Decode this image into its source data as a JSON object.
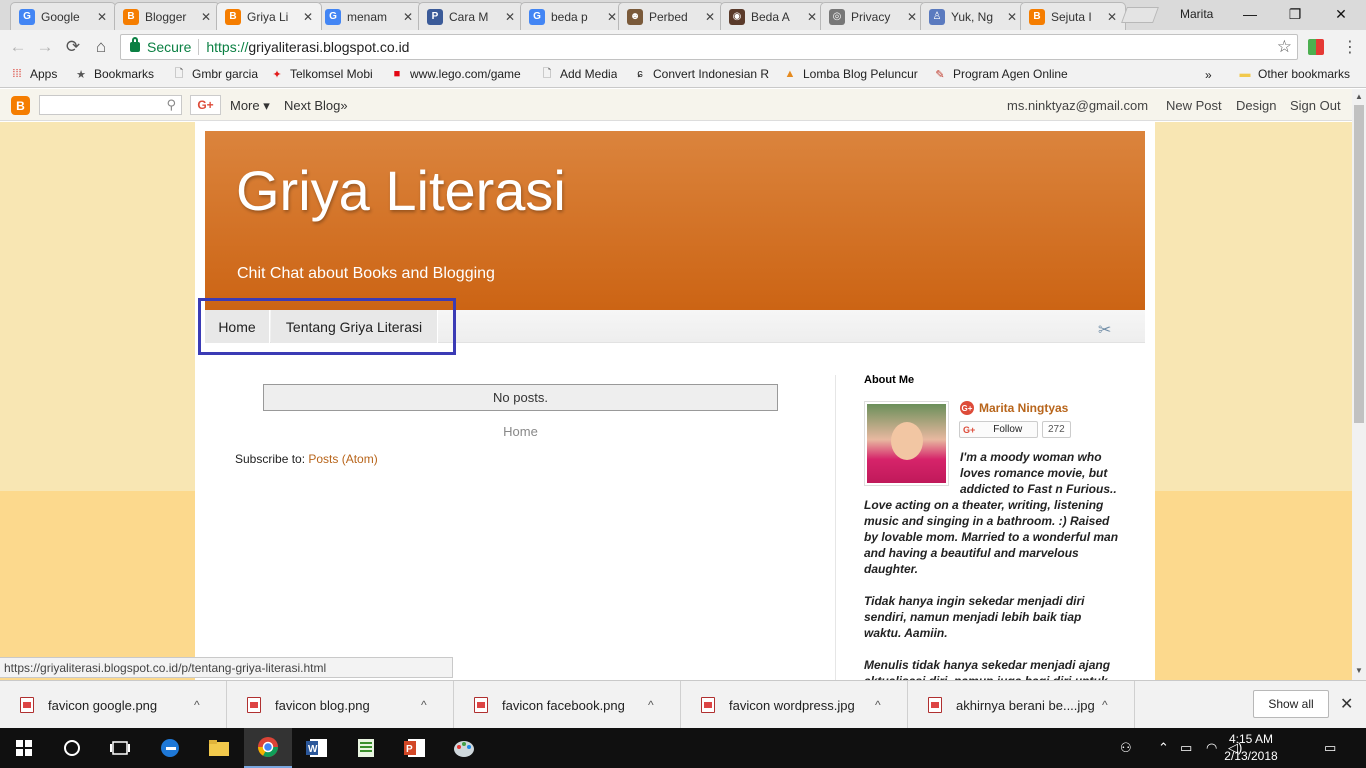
{
  "browser": {
    "tabs": [
      {
        "label": "Google",
        "icon": "google-g-icon",
        "color": "#4285f4",
        "glyph": "G",
        "active": false
      },
      {
        "label": "Blogger",
        "icon": "blogger-icon",
        "color": "#f57d00",
        "glyph": "B",
        "active": false
      },
      {
        "label": "Griya Li",
        "icon": "blogger-icon",
        "color": "#f57d00",
        "glyph": "B",
        "active": true
      },
      {
        "label": "menam",
        "icon": "google-g-icon",
        "color": "#4285f4",
        "glyph": "G",
        "active": false
      },
      {
        "label": "Cara M",
        "icon": "p-icon",
        "color": "#3b5b99",
        "glyph": "P",
        "active": false
      },
      {
        "label": "beda p",
        "icon": "google-g-icon",
        "color": "#4285f4",
        "glyph": "G",
        "active": false
      },
      {
        "label": "Perbed",
        "icon": "person-icon",
        "color": "#7a5a3a",
        "glyph": "☻",
        "active": false
      },
      {
        "label": "Beda A",
        "icon": "circle-logo-icon",
        "color": "#5a3a2a",
        "glyph": "◉",
        "active": false
      },
      {
        "label": "Privacy",
        "icon": "eye-icon",
        "color": "#777777",
        "glyph": "◎",
        "active": false
      },
      {
        "label": "Yuk, Ng",
        "icon": "figure-icon",
        "color": "#5a7abf",
        "glyph": "♙",
        "active": false
      },
      {
        "label": "Sejuta I",
        "icon": "blogger-icon",
        "color": "#f57d00",
        "glyph": "B",
        "active": false
      }
    ],
    "profile_name": "Marita",
    "window_buttons": {
      "minimize": "—",
      "restore": "❐",
      "close": "✕"
    },
    "nav": {
      "back": "←",
      "forward": "→",
      "reload": "⟳",
      "home": "⌂"
    },
    "omnibox": {
      "secure_label": "Secure",
      "url_prefix": "https://",
      "url_rest": "griyaliterasi.blogspot.co.id"
    },
    "star": "☆",
    "menu": "⋮",
    "bookmarks": [
      {
        "label": "Apps",
        "icon": "apps-grid-icon",
        "glyph": "⁞⁞⁞",
        "color": "#d93025"
      },
      {
        "label": "Bookmarks",
        "icon": "star-icon",
        "glyph": "★",
        "color": "#555555"
      },
      {
        "label": "Gmbr garcia",
        "icon": "page-icon",
        "glyph": "🗋",
        "color": "#666666"
      },
      {
        "label": "Telkomsel Mobi",
        "icon": "telkomsel-icon",
        "glyph": "✦",
        "color": "#e21a1a"
      },
      {
        "label": "www.lego.com/game",
        "icon": "lego-icon",
        "glyph": "■",
        "color": "#e30613"
      },
      {
        "label": "Add Media",
        "icon": "page-icon",
        "glyph": "🗋",
        "color": "#666666"
      },
      {
        "label": "Convert Indonesian R",
        "icon": "swirl-icon",
        "glyph": "ɕ",
        "color": "#222222"
      },
      {
        "label": "Lomba Blog Peluncur",
        "icon": "triangle-logo-icon",
        "glyph": "▲",
        "color": "#e58a1f"
      },
      {
        "label": "Program Agen Online",
        "icon": "pen-logo-icon",
        "glyph": "✎",
        "color": "#c0392b"
      },
      {
        "label": "Other bookmarks",
        "icon": "folder-icon",
        "glyph": "▬",
        "color": "#f2c94c"
      }
    ],
    "bookmarks_more": "»"
  },
  "blogger_navbar": {
    "logo": "B",
    "search_icon": "⚲",
    "gplus": "G+",
    "more": "More ▾",
    "next_blog": "Next Blog»",
    "email": "ms.ninktyaz@gmail.com",
    "new_post": "New Post",
    "design": "Design",
    "sign_out": "Sign Out"
  },
  "blog": {
    "title": "Griya Literasi",
    "description": "Chit Chat about Books and Blogging",
    "pages": [
      "Home",
      "Tentang Griya Literasi"
    ],
    "tools_icon": "✂",
    "no_posts": "No posts.",
    "home_link": "Home",
    "subscribe_prefix": "Subscribe to: ",
    "subscribe_link": "Posts (Atom)",
    "highlight_color": "#3b3bb5"
  },
  "sidebar": {
    "title": "About Me",
    "profile_name": "Marita Ningtyas",
    "follow_label": "Follow",
    "follow_count": "272",
    "bio": [
      "I'm a moody woman who loves romance movie, but addicted to Fast n Furious.. Love acting on a theater, writing, listening music and singing in a bathroom. :) Raised by lovable mom. Married to a wonderful man and having a beautiful and marvelous daughter.",
      "Tidak hanya ingin sekedar menjadi diri sendiri, namun menjadi lebih baik tiap waktu. Aamiin.",
      "Menulis tidak hanya sekedar menjadi ajang aktualisasi diri, namun juga bagi diri untuk"
    ]
  },
  "status_url": "https://griyaliterasi.blogspot.co.id/p/tentang-griya-literasi.html",
  "downloads": {
    "items": [
      "favicon google.png",
      "favicon blog.png",
      "favicon facebook.png",
      "favicon wordpress.jpg",
      "akhirnya berani be....jpg"
    ],
    "chevron": "^",
    "show_all": "Show all",
    "close": "✕"
  },
  "taskbar": {
    "time": "4:15 AM",
    "date": "2/13/2018"
  }
}
